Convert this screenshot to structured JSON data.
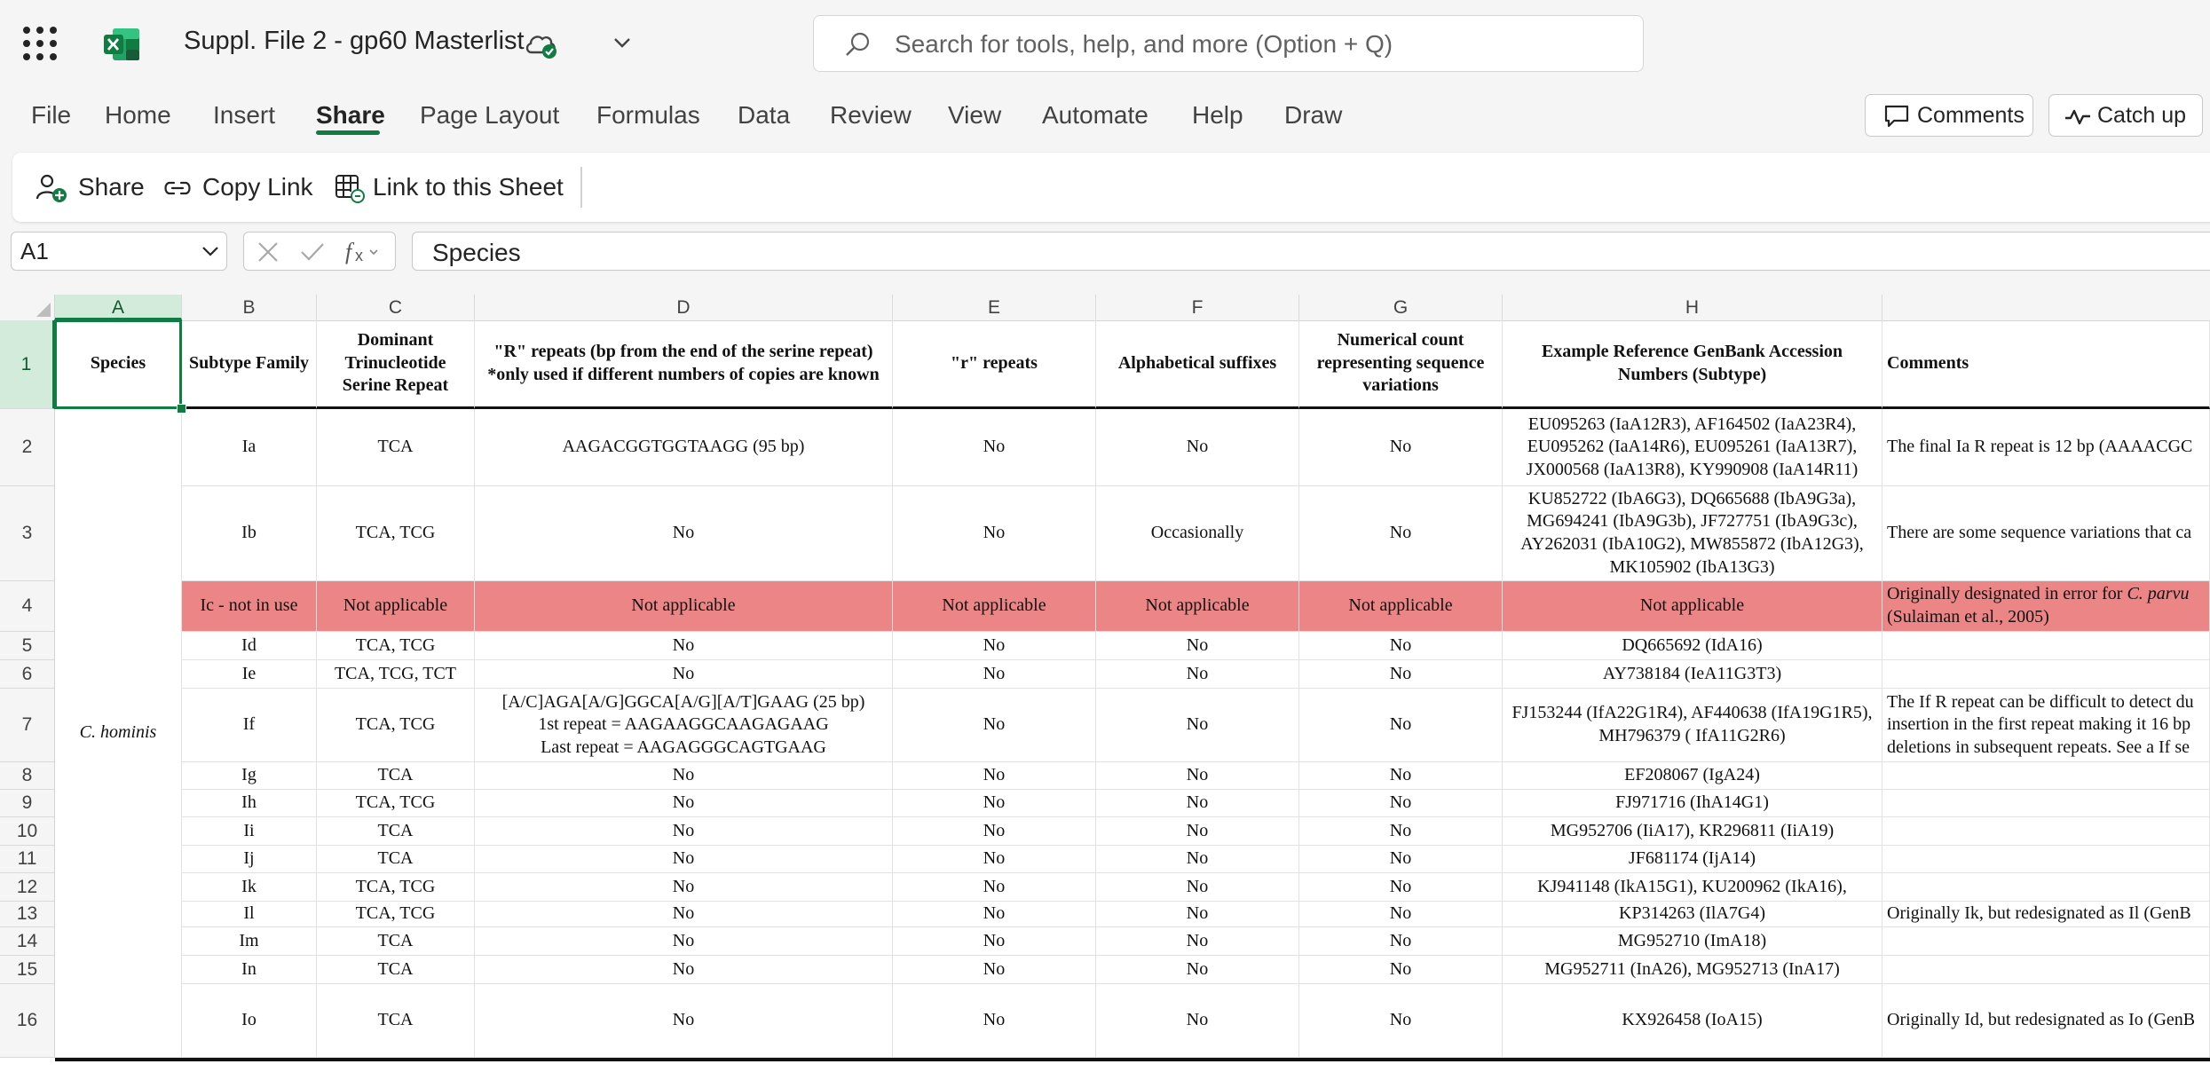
{
  "app": {
    "title": "Suppl. File 2 - gp60 Masterlist",
    "search_placeholder": "Search for tools, help, and more (Option + Q)",
    "brand_color": "#117c41"
  },
  "ribbon": {
    "tabs": [
      {
        "label": "File"
      },
      {
        "label": "Home"
      },
      {
        "label": "Insert"
      },
      {
        "label": "Share"
      },
      {
        "label": "Page Layout"
      },
      {
        "label": "Formulas"
      },
      {
        "label": "Data"
      },
      {
        "label": "Review"
      },
      {
        "label": "View"
      },
      {
        "label": "Automate"
      },
      {
        "label": "Help"
      },
      {
        "label": "Draw"
      }
    ],
    "active_tab": "Share",
    "comments_label": "Comments",
    "catchup_label": "Catch up",
    "toolbar": {
      "share_label": "Share",
      "copy_link_label": "Copy Link",
      "link_sheet_label": "Link to this Sheet"
    }
  },
  "formula_bar": {
    "name_box": "A1",
    "formula": "Species"
  },
  "sheet": {
    "columns": [
      "A",
      "B",
      "C",
      "D",
      "E",
      "F",
      "G",
      "H"
    ],
    "rows": [
      "1",
      "2",
      "3",
      "4",
      "5",
      "6",
      "7",
      "8",
      "9",
      "10",
      "11",
      "12",
      "13",
      "14",
      "15",
      "16"
    ],
    "header": [
      "Species",
      "Subtype Family",
      "Dominant Trinucleotide Serine Repeat",
      "\"R\" repeats (bp from the end of the serine repeat) *only used if different numbers of copies are known",
      "\"r\" repeats",
      "Alphabetical suffixes",
      "Numerical count representing sequence variations",
      "Example Reference GenBank Accession Numbers (Subtype)",
      "Comments"
    ],
    "species": "C. hominis",
    "data_rows": [
      [
        "Ia",
        "TCA",
        "AAGACGGTGGTAAGG (95 bp)",
        "No",
        "No",
        "No",
        "EU095263 (IaA12R3), AF164502 (IaA23R4), EU095262 (IaA14R6), EU095261 (IaA13R7), JX000568 (IaA13R8), KY990908 (IaA14R11)",
        "The final Ia R repeat is 12 bp (AAAACGC"
      ],
      [
        "Ib",
        "TCA, TCG",
        "No",
        "No",
        "Occasionally",
        "No",
        "KU852722 (IbA6G3), DQ665688 (IbA9G3a), MG694241 (IbA9G3b), JF727751 (IbA9G3c), AY262031 (IbA10G2), MW855872 (IbA12G3), MK105902 (IbA13G3)",
        "There are some sequence variations that ca"
      ],
      [
        "Ic - not in use",
        "Not applicable",
        "Not applicable",
        "Not applicable",
        "Not applicable",
        "Not applicable",
        "Not applicable",
        "Originally designated in error for C. parvu"
      ],
      [
        "Id",
        "TCA, TCG",
        "No",
        "No",
        "No",
        "No",
        "DQ665692 (IdA16)",
        ""
      ],
      [
        "Ie",
        "TCA, TCG, TCT",
        "No",
        "No",
        "No",
        "No",
        "AY738184 (IeA11G3T3)",
        ""
      ],
      [
        "If",
        "TCA, TCG",
        "[A/C]AGA[A/G]GGCA[A/G][A/T]GAAG (25 bp)\n1st repeat = AAGAAGGCAAGAGAAG\nLast repeat = AAGAGGGCAGTGAAG",
        "No",
        "No",
        "No",
        "FJ153244 (IfA22G1R4), AF440638 (IfA19G1R5), MH796379 ( IfA11G2R6)",
        "The If R repeat can be difficult to detect du"
      ],
      [
        "Ig",
        "TCA",
        "No",
        "No",
        "No",
        "No",
        "EF208067 (IgA24)",
        ""
      ],
      [
        "Ih",
        "TCA, TCG",
        "No",
        "No",
        "No",
        "No",
        "FJ971716 (IhA14G1)",
        ""
      ],
      [
        "Ii",
        "TCA",
        "No",
        "No",
        "No",
        "No",
        "MG952706 (IiA17), KR296811 (IiA19)",
        ""
      ],
      [
        "Ij",
        "TCA",
        "No",
        "No",
        "No",
        "No",
        "JF681174 (IjA14)",
        ""
      ],
      [
        "Ik",
        "TCA, TCG",
        "No",
        "No",
        "No",
        "No",
        "KJ941148 (IkA15G1), KU200962 (IkA16),",
        ""
      ],
      [
        "Il",
        "TCA, TCG",
        "No",
        "No",
        "No",
        "No",
        "KP314263 (IlA7G4)",
        "Originally Ik, but redesignated as Il (GenB"
      ],
      [
        "Im",
        "TCA",
        "No",
        "No",
        "No",
        "No",
        "MG952710 (ImA18)",
        ""
      ],
      [
        "In",
        "TCA",
        "No",
        "No",
        "No",
        "No",
        "MG952711 (InA26), MG952713 (InA17)",
        ""
      ],
      [
        "Io",
        "TCA",
        "No",
        "No",
        "No",
        "No",
        "KX926458 (IoA15)",
        "Originally Id, but redesignated as Io (GenB"
      ]
    ],
    "comments_extra": {
      "row4_line2": "(Sulaiman et al., 2005)",
      "row7_line2": "insertion in the first repeat making it 16 bp",
      "row7_line3": "deletions in subsequent repeats. See a If se"
    },
    "highlight_color": "#ec8585"
  }
}
